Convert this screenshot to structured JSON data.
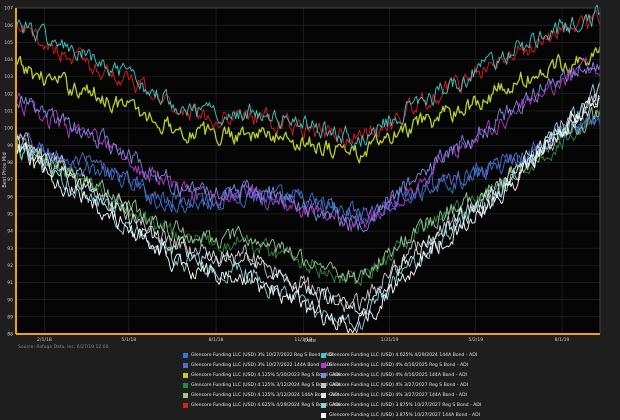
{
  "source_text": "Source: Refuge Data, Inc. 6/27/19 12:00",
  "chart_data": {
    "type": "line",
    "xlabel": "Date",
    "ylabel": "Best Price Mid",
    "ylim": [
      88,
      107
    ],
    "y_ticks": [
      88,
      89,
      90,
      91,
      92,
      93,
      94,
      95,
      96,
      97,
      98,
      99,
      100,
      101,
      102,
      103,
      104,
      105,
      106,
      107
    ],
    "x_ticks": [
      "2/1/18",
      "5/1/18",
      "8/1/18",
      "11/1/18",
      "1/31/19",
      "5/2/19",
      "8/1/19"
    ],
    "x_range": [
      "2018-01-02",
      "2019-09-10"
    ],
    "grid": true,
    "legend_position": "bottom",
    "series": [
      {
        "name": "Glencore Funding LLC (USD) 3% 10/27/2022 Reg S Bond - ADI",
        "color": "#2f78d0",
        "x": [
          "2018-01-02",
          "2018-02-01",
          "2018-03-01",
          "2018-04-01",
          "2018-05-01",
          "2018-06-01",
          "2018-07-01",
          "2018-08-01",
          "2018-09-01",
          "2018-10-01",
          "2018-11-01",
          "2018-12-01",
          "2019-01-01",
          "2019-01-31",
          "2019-03-01",
          "2019-04-01",
          "2019-05-02",
          "2019-06-01",
          "2019-07-01",
          "2019-08-01",
          "2019-09-10"
        ],
        "values": [
          99.2,
          98.4,
          98.0,
          97.5,
          96.8,
          95.9,
          95.6,
          95.8,
          96.2,
          95.9,
          95.8,
          95.3,
          94.8,
          95.6,
          96.3,
          96.8,
          97.3,
          98.0,
          98.7,
          99.6,
          100.4
        ]
      },
      {
        "name": "Glencore Funding LLC (USD) 3% 10/27/2022 144A Bond - ADI",
        "color": "#5a68c8",
        "x": [
          "2018-01-02",
          "2018-02-01",
          "2018-03-01",
          "2018-04-01",
          "2018-05-01",
          "2018-06-01",
          "2018-07-01",
          "2018-08-01",
          "2018-09-01",
          "2018-10-01",
          "2018-11-01",
          "2018-12-01",
          "2019-01-01",
          "2019-01-31",
          "2019-03-01",
          "2019-04-01",
          "2019-05-02",
          "2019-06-01",
          "2019-07-01",
          "2019-08-01",
          "2019-09-10"
        ],
        "values": [
          99.4,
          98.6,
          98.1,
          97.6,
          96.9,
          96.0,
          95.7,
          95.9,
          96.3,
          96.0,
          95.9,
          95.4,
          94.9,
          95.7,
          96.4,
          96.9,
          97.4,
          98.1,
          98.8,
          99.8,
          100.6
        ]
      },
      {
        "name": "Glencore Funding LLC (USD) 4.125% 5/30/2023 Reg S Bond - ADI",
        "color": "#b8cf2a",
        "x": [
          "2018-01-02",
          "2018-02-01",
          "2018-03-01",
          "2018-04-01",
          "2018-05-01",
          "2018-06-01",
          "2018-07-01",
          "2018-08-01",
          "2018-09-01",
          "2018-10-01",
          "2018-11-01",
          "2018-12-01",
          "2019-01-01",
          "2019-01-31",
          "2019-03-01",
          "2019-04-01",
          "2019-05-02",
          "2019-06-01",
          "2019-07-01",
          "2019-08-01",
          "2019-09-10"
        ],
        "values": [
          103.6,
          102.9,
          102.4,
          101.9,
          101.2,
          100.4,
          99.8,
          99.6,
          99.8,
          99.5,
          99.2,
          98.9,
          98.5,
          99.4,
          100.1,
          100.8,
          101.5,
          102.3,
          103.0,
          103.8,
          104.4
        ]
      },
      {
        "name": "Glencore Funding LLC (USD) 4.125% 3/12/2024 Reg S Bond - ADI",
        "color": "#2c8c3a",
        "x": [
          "2018-01-02",
          "2018-02-01",
          "2018-03-01",
          "2018-04-01",
          "2018-05-01",
          "2018-06-01",
          "2018-07-01",
          "2018-08-01",
          "2018-09-01",
          "2018-10-01",
          "2018-11-01",
          "2018-12-01",
          "2019-01-01",
          "2019-01-31",
          "2019-03-01",
          "2019-04-01",
          "2019-05-02",
          "2019-06-01",
          "2019-07-01",
          "2019-08-01",
          "2019-09-10"
        ],
        "values": [
          98.9,
          97.9,
          97.2,
          96.4,
          95.4,
          94.3,
          93.6,
          93.3,
          93.4,
          92.8,
          92.3,
          91.6,
          91.1,
          92.6,
          93.9,
          94.8,
          95.7,
          96.8,
          98.0,
          99.4,
          100.8
        ]
      },
      {
        "name": "Glencore Funding LLC (USD) 4.125% 3/12/2024 144A Bond - ADI",
        "color": "#9ac49a",
        "x": [
          "2018-01-02",
          "2018-02-01",
          "2018-03-01",
          "2018-04-01",
          "2018-05-01",
          "2018-06-01",
          "2018-07-01",
          "2018-08-01",
          "2018-09-01",
          "2018-10-01",
          "2018-11-01",
          "2018-12-01",
          "2019-01-01",
          "2019-01-31",
          "2019-03-01",
          "2019-04-01",
          "2019-05-02",
          "2019-06-01",
          "2019-07-01",
          "2019-08-01",
          "2019-09-10"
        ],
        "values": [
          99.1,
          98.1,
          97.4,
          96.6,
          95.6,
          94.5,
          93.8,
          93.5,
          93.6,
          93.0,
          92.5,
          91.8,
          91.3,
          92.8,
          94.1,
          95.0,
          95.9,
          97.0,
          98.2,
          99.6,
          101.0
        ]
      },
      {
        "name": "Glencore Funding LLC (USD) 4.625% 4/29/2024 Reg S Bond - ADI",
        "color": "#e01c1c",
        "x": [
          "2018-01-02",
          "2018-02-01",
          "2018-03-01",
          "2018-04-01",
          "2018-05-01",
          "2018-06-01",
          "2018-07-01",
          "2018-08-01",
          "2018-09-01",
          "2018-10-01",
          "2018-11-01",
          "2018-12-01",
          "2019-01-01",
          "2019-01-31",
          "2019-03-01",
          "2019-04-01",
          "2019-05-02",
          "2019-06-01",
          "2019-07-01",
          "2019-08-01",
          "2019-09-10"
        ],
        "values": [
          105.8,
          104.9,
          104.2,
          103.5,
          102.7,
          101.8,
          101.0,
          100.6,
          100.8,
          100.4,
          100.0,
          99.7,
          99.3,
          100.3,
          101.3,
          102.2,
          103.1,
          104.0,
          104.9,
          105.6,
          106.3
        ]
      },
      {
        "name": "Glencore Funding LLC (USD) 4.625% 4/29/2024 144A Bond - ADI",
        "color": "#3fc8c8",
        "x": [
          "2018-01-02",
          "2018-02-01",
          "2018-03-01",
          "2018-04-01",
          "2018-05-01",
          "2018-06-01",
          "2018-07-01",
          "2018-08-01",
          "2018-09-01",
          "2018-10-01",
          "2018-11-01",
          "2018-12-01",
          "2019-01-01",
          "2019-01-31",
          "2019-03-01",
          "2019-04-01",
          "2019-05-02",
          "2019-06-01",
          "2019-07-01",
          "2019-08-01",
          "2019-09-10"
        ],
        "values": [
          106.2,
          105.3,
          104.5,
          103.7,
          102.9,
          102.0,
          101.2,
          100.8,
          101.0,
          100.6,
          100.2,
          99.9,
          99.4,
          100.5,
          101.5,
          102.4,
          103.3,
          104.2,
          105.0,
          105.8,
          106.6
        ]
      },
      {
        "name": "Glencore Funding LLC (USD) 4% 4/16/2025 Reg S Bond - ADI",
        "color": "#b43ad0",
        "x": [
          "2018-01-02",
          "2018-02-01",
          "2018-03-01",
          "2018-04-01",
          "2018-05-01",
          "2018-06-01",
          "2018-07-01",
          "2018-08-01",
          "2018-09-01",
          "2018-10-01",
          "2018-11-01",
          "2018-12-01",
          "2019-01-01",
          "2019-01-31",
          "2019-03-01",
          "2019-04-01",
          "2019-05-02",
          "2019-06-01",
          "2019-07-01",
          "2019-08-01",
          "2019-09-10"
        ],
        "values": [
          101.6,
          100.6,
          99.9,
          99.1,
          98.1,
          97.0,
          96.3,
          96.1,
          96.3,
          95.8,
          95.3,
          94.7,
          94.1,
          95.6,
          97.0,
          98.2,
          99.4,
          100.6,
          101.8,
          102.9,
          103.8
        ]
      },
      {
        "name": "Glencore Funding LLC (USD) 4% 4/16/2025 144A Bond - ADI",
        "color": "#7a8ad8",
        "x": [
          "2018-01-02",
          "2018-02-01",
          "2018-03-01",
          "2018-04-01",
          "2018-05-01",
          "2018-06-01",
          "2018-07-01",
          "2018-08-01",
          "2018-09-01",
          "2018-10-01",
          "2018-11-01",
          "2018-12-01",
          "2019-01-01",
          "2019-01-31",
          "2019-03-01",
          "2019-04-01",
          "2019-05-02",
          "2019-06-01",
          "2019-07-01",
          "2019-08-01",
          "2019-09-10"
        ],
        "values": [
          101.8,
          100.8,
          100.1,
          99.3,
          98.3,
          97.2,
          96.5,
          96.3,
          96.5,
          96.0,
          95.5,
          94.9,
          94.3,
          95.8,
          97.2,
          98.4,
          99.6,
          100.8,
          102.0,
          103.1,
          104.0
        ]
      },
      {
        "name": "Glencore Funding LLC (USD) 4% 3/27/2027 Reg S Bond - ADI",
        "color": "#c8c8c8",
        "x": [
          "2018-01-02",
          "2018-02-01",
          "2018-03-01",
          "2018-04-01",
          "2018-05-01",
          "2018-06-01",
          "2018-07-01",
          "2018-08-01",
          "2018-09-01",
          "2018-10-01",
          "2018-11-01",
          "2018-12-01",
          "2019-01-01",
          "2019-01-31",
          "2019-03-01",
          "2019-04-01",
          "2019-05-02",
          "2019-06-01",
          "2019-07-01",
          "2019-08-01",
          "2019-09-10"
        ],
        "values": [
          99.6,
          98.3,
          97.4,
          96.4,
          95.1,
          93.8,
          92.9,
          92.6,
          92.6,
          91.7,
          90.9,
          90.1,
          89.6,
          91.4,
          93.1,
          94.3,
          95.5,
          96.9,
          98.5,
          100.2,
          102.0
        ]
      },
      {
        "name": "Glencore Funding LLC (USD) 4% 3/27/2027 144A Bond - ADI",
        "color": "#d8eaea",
        "x": [
          "2018-01-02",
          "2018-02-01",
          "2018-03-01",
          "2018-04-01",
          "2018-05-01",
          "2018-06-01",
          "2018-07-01",
          "2018-08-01",
          "2018-09-01",
          "2018-10-01",
          "2018-11-01",
          "2018-12-01",
          "2019-01-01",
          "2019-01-31",
          "2019-03-01",
          "2019-04-01",
          "2019-05-02",
          "2019-06-01",
          "2019-07-01",
          "2019-08-01",
          "2019-09-10"
        ],
        "values": [
          99.4,
          98.1,
          97.2,
          96.2,
          94.9,
          93.6,
          92.7,
          92.4,
          92.4,
          91.5,
          90.7,
          89.9,
          89.3,
          91.2,
          92.9,
          94.1,
          95.3,
          96.7,
          98.3,
          100.0,
          101.8
        ]
      },
      {
        "name": "Glencore Funding LLC (USD) 3.875% 10/27/2027 Reg S Bond - ADI",
        "color": "#8fd0e0",
        "x": [
          "2018-01-02",
          "2018-02-01",
          "2018-03-01",
          "2018-04-01",
          "2018-05-01",
          "2018-06-01",
          "2018-07-01",
          "2018-08-01",
          "2018-09-01",
          "2018-10-01",
          "2018-11-01",
          "2018-12-01",
          "2019-01-01",
          "2019-01-31",
          "2019-03-01",
          "2019-04-01",
          "2019-05-02",
          "2019-06-01",
          "2019-07-01",
          "2019-08-01",
          "2019-09-10"
        ],
        "values": [
          99.0,
          97.7,
          96.7,
          95.6,
          94.3,
          93.0,
          92.1,
          91.7,
          91.6,
          90.6,
          89.7,
          89.0,
          88.7,
          90.6,
          92.4,
          93.7,
          95.0,
          96.5,
          98.2,
          100.1,
          102.2
        ]
      },
      {
        "name": "Glencore Funding LLC (USD) 3.875% 10/27/2027 144A Bond - ADI",
        "color": "#ffffff",
        "x": [
          "2018-01-02",
          "2018-02-01",
          "2018-03-01",
          "2018-04-01",
          "2018-05-01",
          "2018-06-01",
          "2018-07-01",
          "2018-08-01",
          "2018-09-01",
          "2018-10-01",
          "2018-11-01",
          "2018-12-01",
          "2019-01-01",
          "2019-01-31",
          "2019-03-01",
          "2019-04-01",
          "2019-05-02",
          "2019-06-01",
          "2019-07-01",
          "2019-08-01",
          "2019-09-10"
        ],
        "values": [
          98.8,
          97.5,
          96.5,
          95.4,
          94.1,
          92.8,
          91.9,
          91.5,
          91.4,
          90.4,
          89.5,
          88.8,
          88.6,
          90.4,
          92.2,
          93.5,
          94.8,
          96.3,
          98.0,
          99.9,
          102.0
        ]
      }
    ]
  }
}
